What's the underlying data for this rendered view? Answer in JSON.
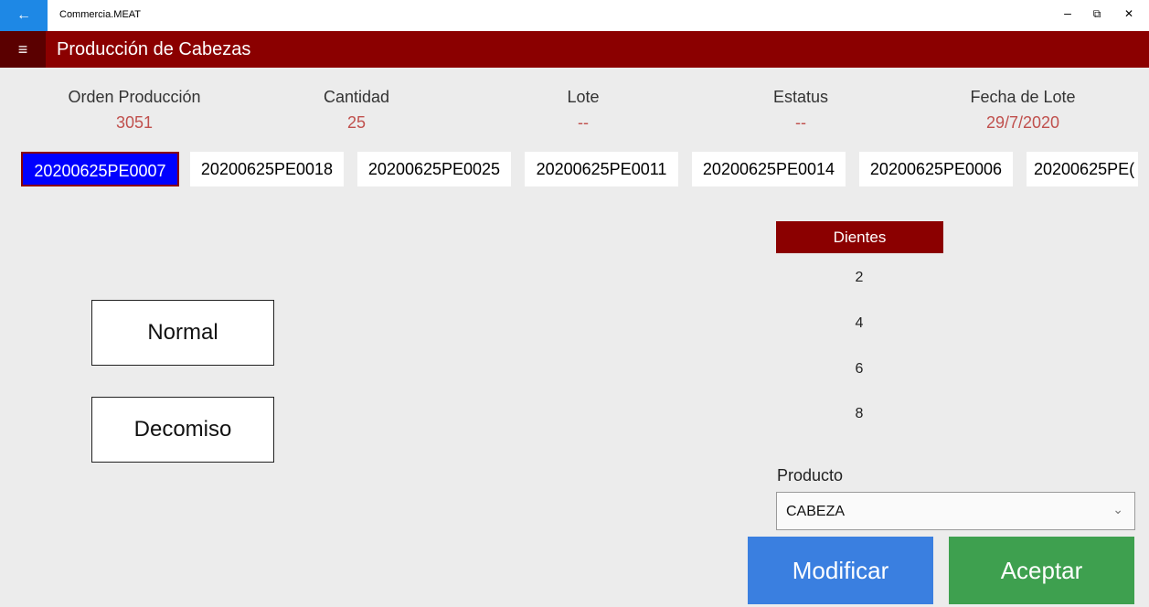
{
  "window": {
    "title": "Commercia.MEAT",
    "back_icon": "←",
    "minimize_icon": "–",
    "restore_icon": "⧉",
    "close_icon": "✕"
  },
  "header": {
    "menu_icon": "≡",
    "title": "Producción de Cabezas"
  },
  "info": [
    {
      "label": "Orden Producción",
      "value": "3051"
    },
    {
      "label": "Cantidad",
      "value": "25"
    },
    {
      "label": "Lote",
      "value": "--"
    },
    {
      "label": "Estatus",
      "value": "--"
    },
    {
      "label": "Fecha de Lote",
      "value": "29/7/2020"
    }
  ],
  "lots": [
    "20200625PE0007",
    "20200625PE0018",
    "20200625PE0025",
    "20200625PE0011",
    "20200625PE0014",
    "20200625PE0006",
    "20200625PE("
  ],
  "selected_lot": "20200625PE0007",
  "buttons": {
    "normal": "Normal",
    "decomiso": "Decomiso",
    "modificar": "Modificar",
    "aceptar": "Aceptar"
  },
  "dientes": {
    "header": "Dientes",
    "options": [
      "2",
      "4",
      "6",
      "8"
    ]
  },
  "producto": {
    "label": "Producto",
    "selected": "CABEZA",
    "chevron_icon": "⌄"
  },
  "colors": {
    "header": "#8b0000",
    "selected_lot": "#0000ff",
    "value_text": "#c0504d",
    "modificar": "#3a7fe0",
    "aceptar": "#3ea04f"
  }
}
